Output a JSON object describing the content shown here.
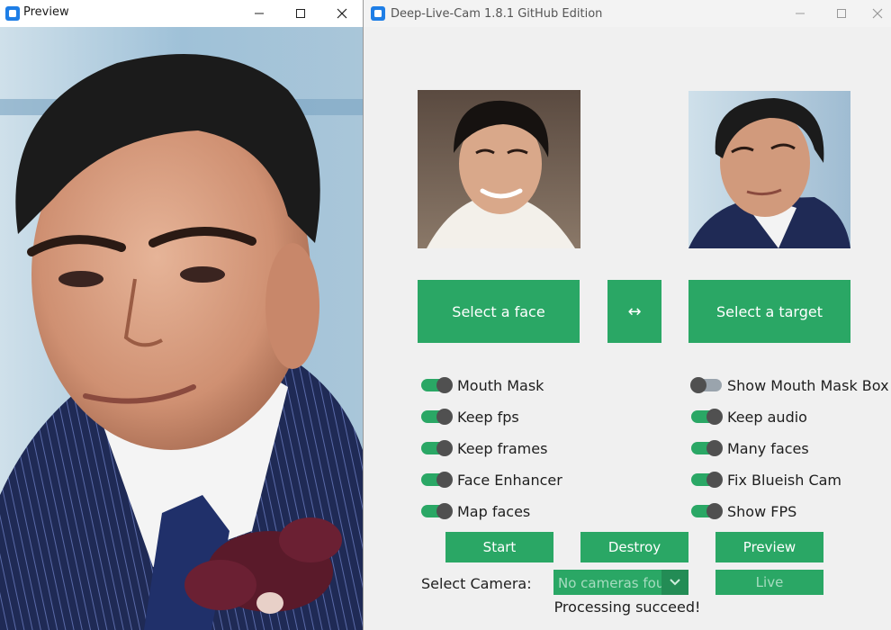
{
  "preview_window": {
    "title": "Preview",
    "controls": {
      "minimize": "minimize-icon",
      "maximize": "maximize-icon",
      "close": "close-icon"
    }
  },
  "main_window": {
    "title": "Deep-Live-Cam 1.8.1 GitHub Edition",
    "controls": {
      "minimize": "minimize-icon",
      "maximize": "maximize-icon",
      "close": "close-icon"
    }
  },
  "buttons": {
    "select_face": "Select a face",
    "swap": "↔",
    "select_target": "Select a target",
    "start": "Start",
    "destroy": "Destroy",
    "preview": "Preview",
    "live": "Live"
  },
  "toggles_left": [
    {
      "label": "Mouth Mask",
      "on": true
    },
    {
      "label": "Keep fps",
      "on": true
    },
    {
      "label": "Keep frames",
      "on": true
    },
    {
      "label": "Face Enhancer",
      "on": true
    },
    {
      "label": "Map faces",
      "on": true
    }
  ],
  "toggles_right": [
    {
      "label": "Show Mouth Mask Box",
      "on": false
    },
    {
      "label": "Keep audio",
      "on": true
    },
    {
      "label": "Many faces",
      "on": true
    },
    {
      "label": "Fix Blueish Cam",
      "on": true
    },
    {
      "label": "Show FPS",
      "on": true
    }
  ],
  "camera": {
    "label": "Select Camera:",
    "value": "No cameras found"
  },
  "status": "Processing succeed!",
  "colors": {
    "accent": "#2aa765",
    "background": "#f0f0f0",
    "knob": "#505050"
  }
}
